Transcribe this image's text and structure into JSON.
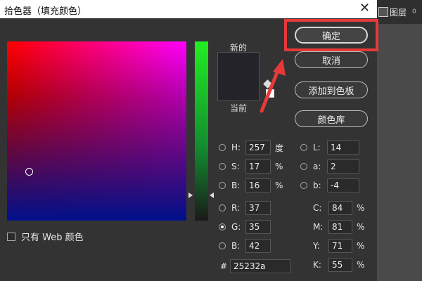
{
  "window": {
    "title": "拾色器（填充颜色）",
    "close_glyph": "✕"
  },
  "side_panel": {
    "layers_label": "图层",
    "layers_count": "0"
  },
  "buttons": {
    "ok": "确定",
    "cancel": "取消",
    "add_swatch": "添加到色板",
    "color_library": "颜色库"
  },
  "preview": {
    "new_label": "新的",
    "current_label": "当前",
    "color_hex": "#25232a"
  },
  "web_only": {
    "label": "只有 Web 颜色",
    "checked": false
  },
  "hsb": {
    "h": {
      "label": "H:",
      "value": "257",
      "unit": "度"
    },
    "s": {
      "label": "S:",
      "value": "17",
      "unit": "%"
    },
    "b": {
      "label": "B:",
      "value": "16",
      "unit": "%"
    }
  },
  "lab": {
    "l": {
      "label": "L:",
      "value": "14"
    },
    "a": {
      "label": "a:",
      "value": "2"
    },
    "b": {
      "label": "b:",
      "value": "-4"
    }
  },
  "rgb": {
    "r": {
      "label": "R:",
      "value": "37"
    },
    "g": {
      "label": "G:",
      "value": "35"
    },
    "b": {
      "label": "B:",
      "value": "42"
    },
    "selected": "G"
  },
  "cmyk": {
    "c": {
      "label": "C:",
      "value": "84",
      "unit": "%"
    },
    "m": {
      "label": "M:",
      "value": "81",
      "unit": "%"
    },
    "y": {
      "label": "Y:",
      "value": "71",
      "unit": "%"
    },
    "k": {
      "label": "K:",
      "value": "55",
      "unit": "%"
    }
  },
  "hex": {
    "label": "#",
    "value": "25232a"
  },
  "colors": {
    "highlight": "#e63a3a",
    "background": "#333333"
  }
}
